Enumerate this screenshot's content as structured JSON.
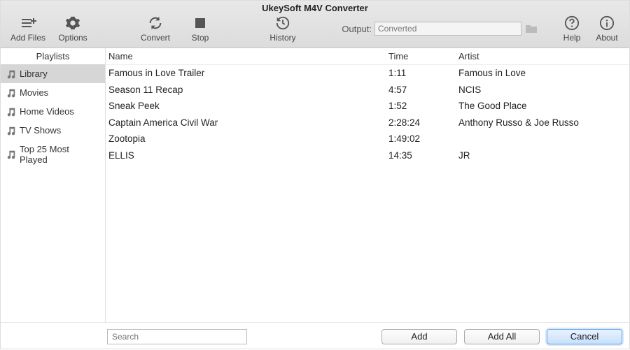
{
  "app": {
    "title": "UkeySoft M4V Converter"
  },
  "toolbar": {
    "add_files": "Add Files",
    "options": "Options",
    "convert": "Convert",
    "stop": "Stop",
    "history": "History",
    "output_label": "Output:",
    "output_value": "Converted",
    "help": "Help",
    "about": "About"
  },
  "sidebar": {
    "header": "Playlists",
    "items": [
      {
        "label": "Library"
      },
      {
        "label": "Movies"
      },
      {
        "label": "Home Videos"
      },
      {
        "label": "TV Shows"
      },
      {
        "label": "Top 25 Most Played"
      }
    ],
    "selected_index": 0
  },
  "table": {
    "columns": {
      "name": "Name",
      "time": "Time",
      "artist": "Artist"
    },
    "rows": [
      {
        "name": "Famous in Love  Trailer",
        "time": "1:11",
        "artist": "Famous in Love"
      },
      {
        "name": "Season 11 Recap",
        "time": "4:57",
        "artist": "NCIS"
      },
      {
        "name": "Sneak Peek",
        "time": "1:52",
        "artist": "The Good Place"
      },
      {
        "name": "Captain America  Civil War",
        "time": "2:28:24",
        "artist": "Anthony Russo & Joe Russo"
      },
      {
        "name": "Zootopia",
        "time": "1:49:02",
        "artist": ""
      },
      {
        "name": "ELLIS",
        "time": "14:35",
        "artist": "JR"
      }
    ]
  },
  "footer": {
    "search_placeholder": "Search",
    "add": "Add",
    "add_all": "Add All",
    "cancel": "Cancel"
  }
}
